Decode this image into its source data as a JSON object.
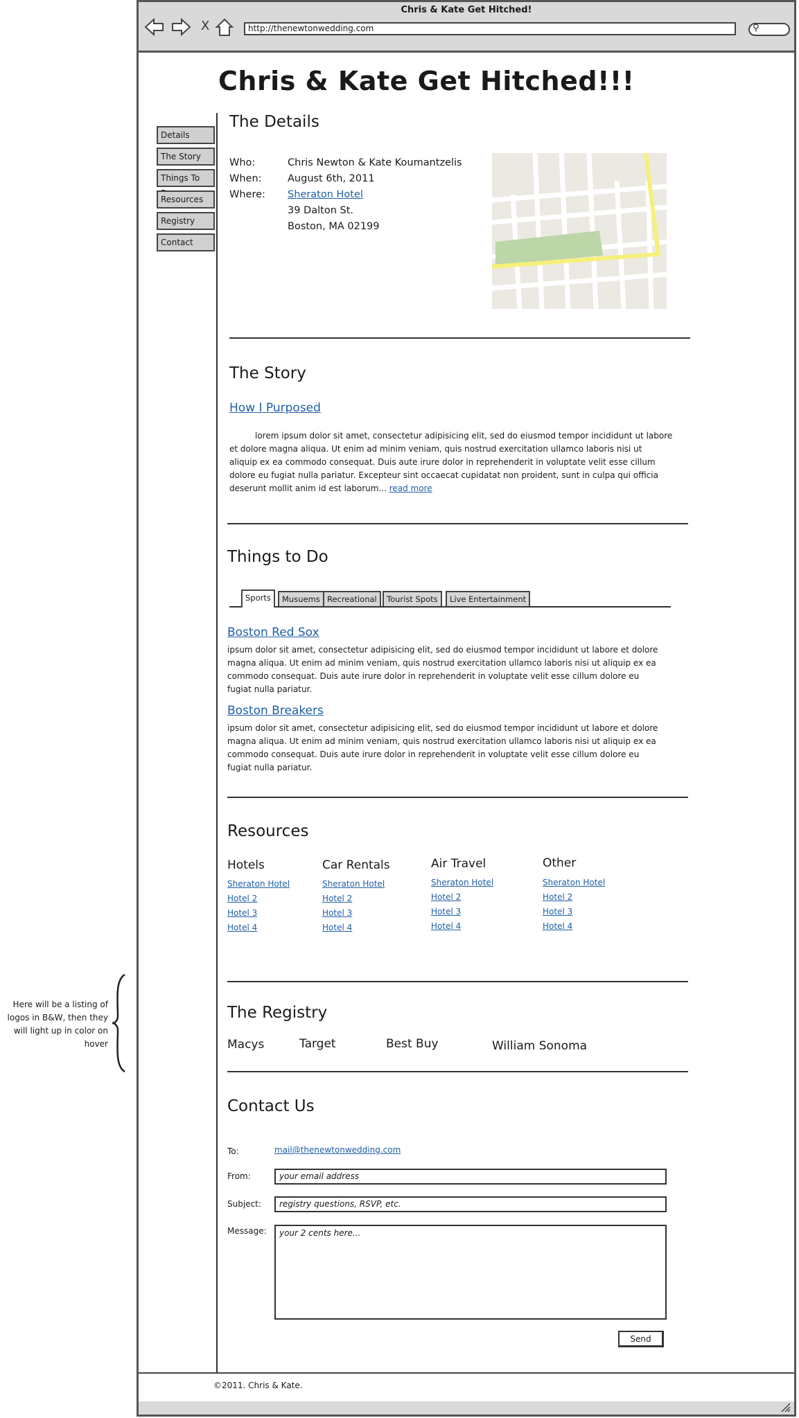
{
  "browser": {
    "title": "Chris & Kate Get Hitched!",
    "url": "http://thenewtonwedding.com",
    "close_glyph": "X"
  },
  "site_title": "Chris & Kate Get Hitched!!!",
  "sidebar": {
    "items": [
      {
        "label": "Details"
      },
      {
        "label": "The Story"
      },
      {
        "label": "Things To Do"
      },
      {
        "label": "Resources"
      },
      {
        "label": "Registry"
      },
      {
        "label": "Contact"
      }
    ]
  },
  "details": {
    "heading": "The Details",
    "who_label": "Who:",
    "who": "Chris Newton & Kate Koumantzelis",
    "when_label": "When:",
    "when": "August 6th, 2011",
    "where_label": "Where:",
    "where_link": "Sheraton Hotel",
    "address1": "39 Dalton St.",
    "address2": "Boston, MA 02199"
  },
  "story": {
    "heading": "The Story",
    "link": "How I Purposed",
    "lines": [
      "lorem ipsum dolor sit amet, consectetur adipisicing elit, sed do eiusmod tempor incididunt ut labore",
      "et dolore magna aliqua. Ut enim ad minim veniam, quis nostrud exercitation ullamco laboris nisi ut",
      "aliquip ex ea commodo consequat. Duis aute irure dolor in reprehenderit in voluptate velit esse cillum",
      "dolore eu fugiat nulla pariatur. Excepteur sint occaecat cupidatat non proident, sunt in culpa qui officia",
      "deserunt mollit anim id est laborum..."
    ],
    "read_more": "read more"
  },
  "things": {
    "heading": "Things to Do",
    "tabs": [
      "Sports",
      "Musuems",
      "Recreational",
      "Tourist Spots",
      "Live Entertainment"
    ],
    "items": [
      {
        "title": "Boston Red Sox",
        "lines": [
          "ipsum dolor sit amet, consectetur adipisicing elit, sed do eiusmod tempor incididunt ut labore et dolore",
          "magna aliqua. Ut enim ad minim veniam, quis nostrud exercitation ullamco laboris nisi ut aliquip ex ea",
          "commodo consequat. Duis aute irure dolor in reprehenderit in voluptate velit esse cillum dolore eu",
          "fugiat nulla pariatur."
        ]
      },
      {
        "title": "Boston Breakers",
        "lines": [
          "ipsum dolor sit amet, consectetur adipisicing elit, sed do eiusmod tempor incididunt ut labore et dolore",
          "magna aliqua. Ut enim ad minim veniam, quis nostrud exercitation ullamco laboris nisi ut aliquip ex ea",
          "commodo consequat. Duis aute irure dolor in reprehenderit in voluptate velit esse cillum dolore eu",
          "fugiat nulla pariatur."
        ]
      }
    ]
  },
  "resources": {
    "heading": "Resources",
    "columns": [
      {
        "title": "Hotels",
        "links": [
          "Sheraton Hotel",
          "Hotel 2",
          "Hotel 3",
          "Hotel 4"
        ]
      },
      {
        "title": "Car Rentals",
        "links": [
          "Sheraton Hotel",
          "Hotel 2",
          "Hotel 3",
          "Hotel 4"
        ]
      },
      {
        "title": "Air Travel",
        "links": [
          "Sheraton Hotel",
          "Hotel 2",
          "Hotel 3",
          "Hotel 4"
        ]
      },
      {
        "title": "Other",
        "links": [
          "Sheraton Hotel",
          "Hotel 2",
          "Hotel 3",
          "Hotel 4"
        ]
      }
    ]
  },
  "registry": {
    "heading": "The Registry",
    "brands": [
      "Macys",
      "Target",
      "Best Buy",
      "William Sonoma"
    ]
  },
  "contact": {
    "heading": "Contact Us",
    "to_label": "To:",
    "to_email": "mail@thenewtonwedding.com",
    "from_label": "From:",
    "from_placeholder": "your email address",
    "subject_label": "Subject:",
    "subject_placeholder": "registry questions, RSVP, etc.",
    "message_label": "Message:",
    "message_placeholder": "your 2 cents here...",
    "send_label": "Send"
  },
  "footer": "©2011. Chris & Kate.",
  "annotation": [
    "Here will be a listing of",
    "logos in B&W, then they",
    "will light up in color on",
    "hover"
  ],
  "colors": {
    "link": "#1f5fa6",
    "map_park": "#bcd6a8",
    "map_highway": "#f6f07a",
    "frame": "#d9d9d9"
  }
}
